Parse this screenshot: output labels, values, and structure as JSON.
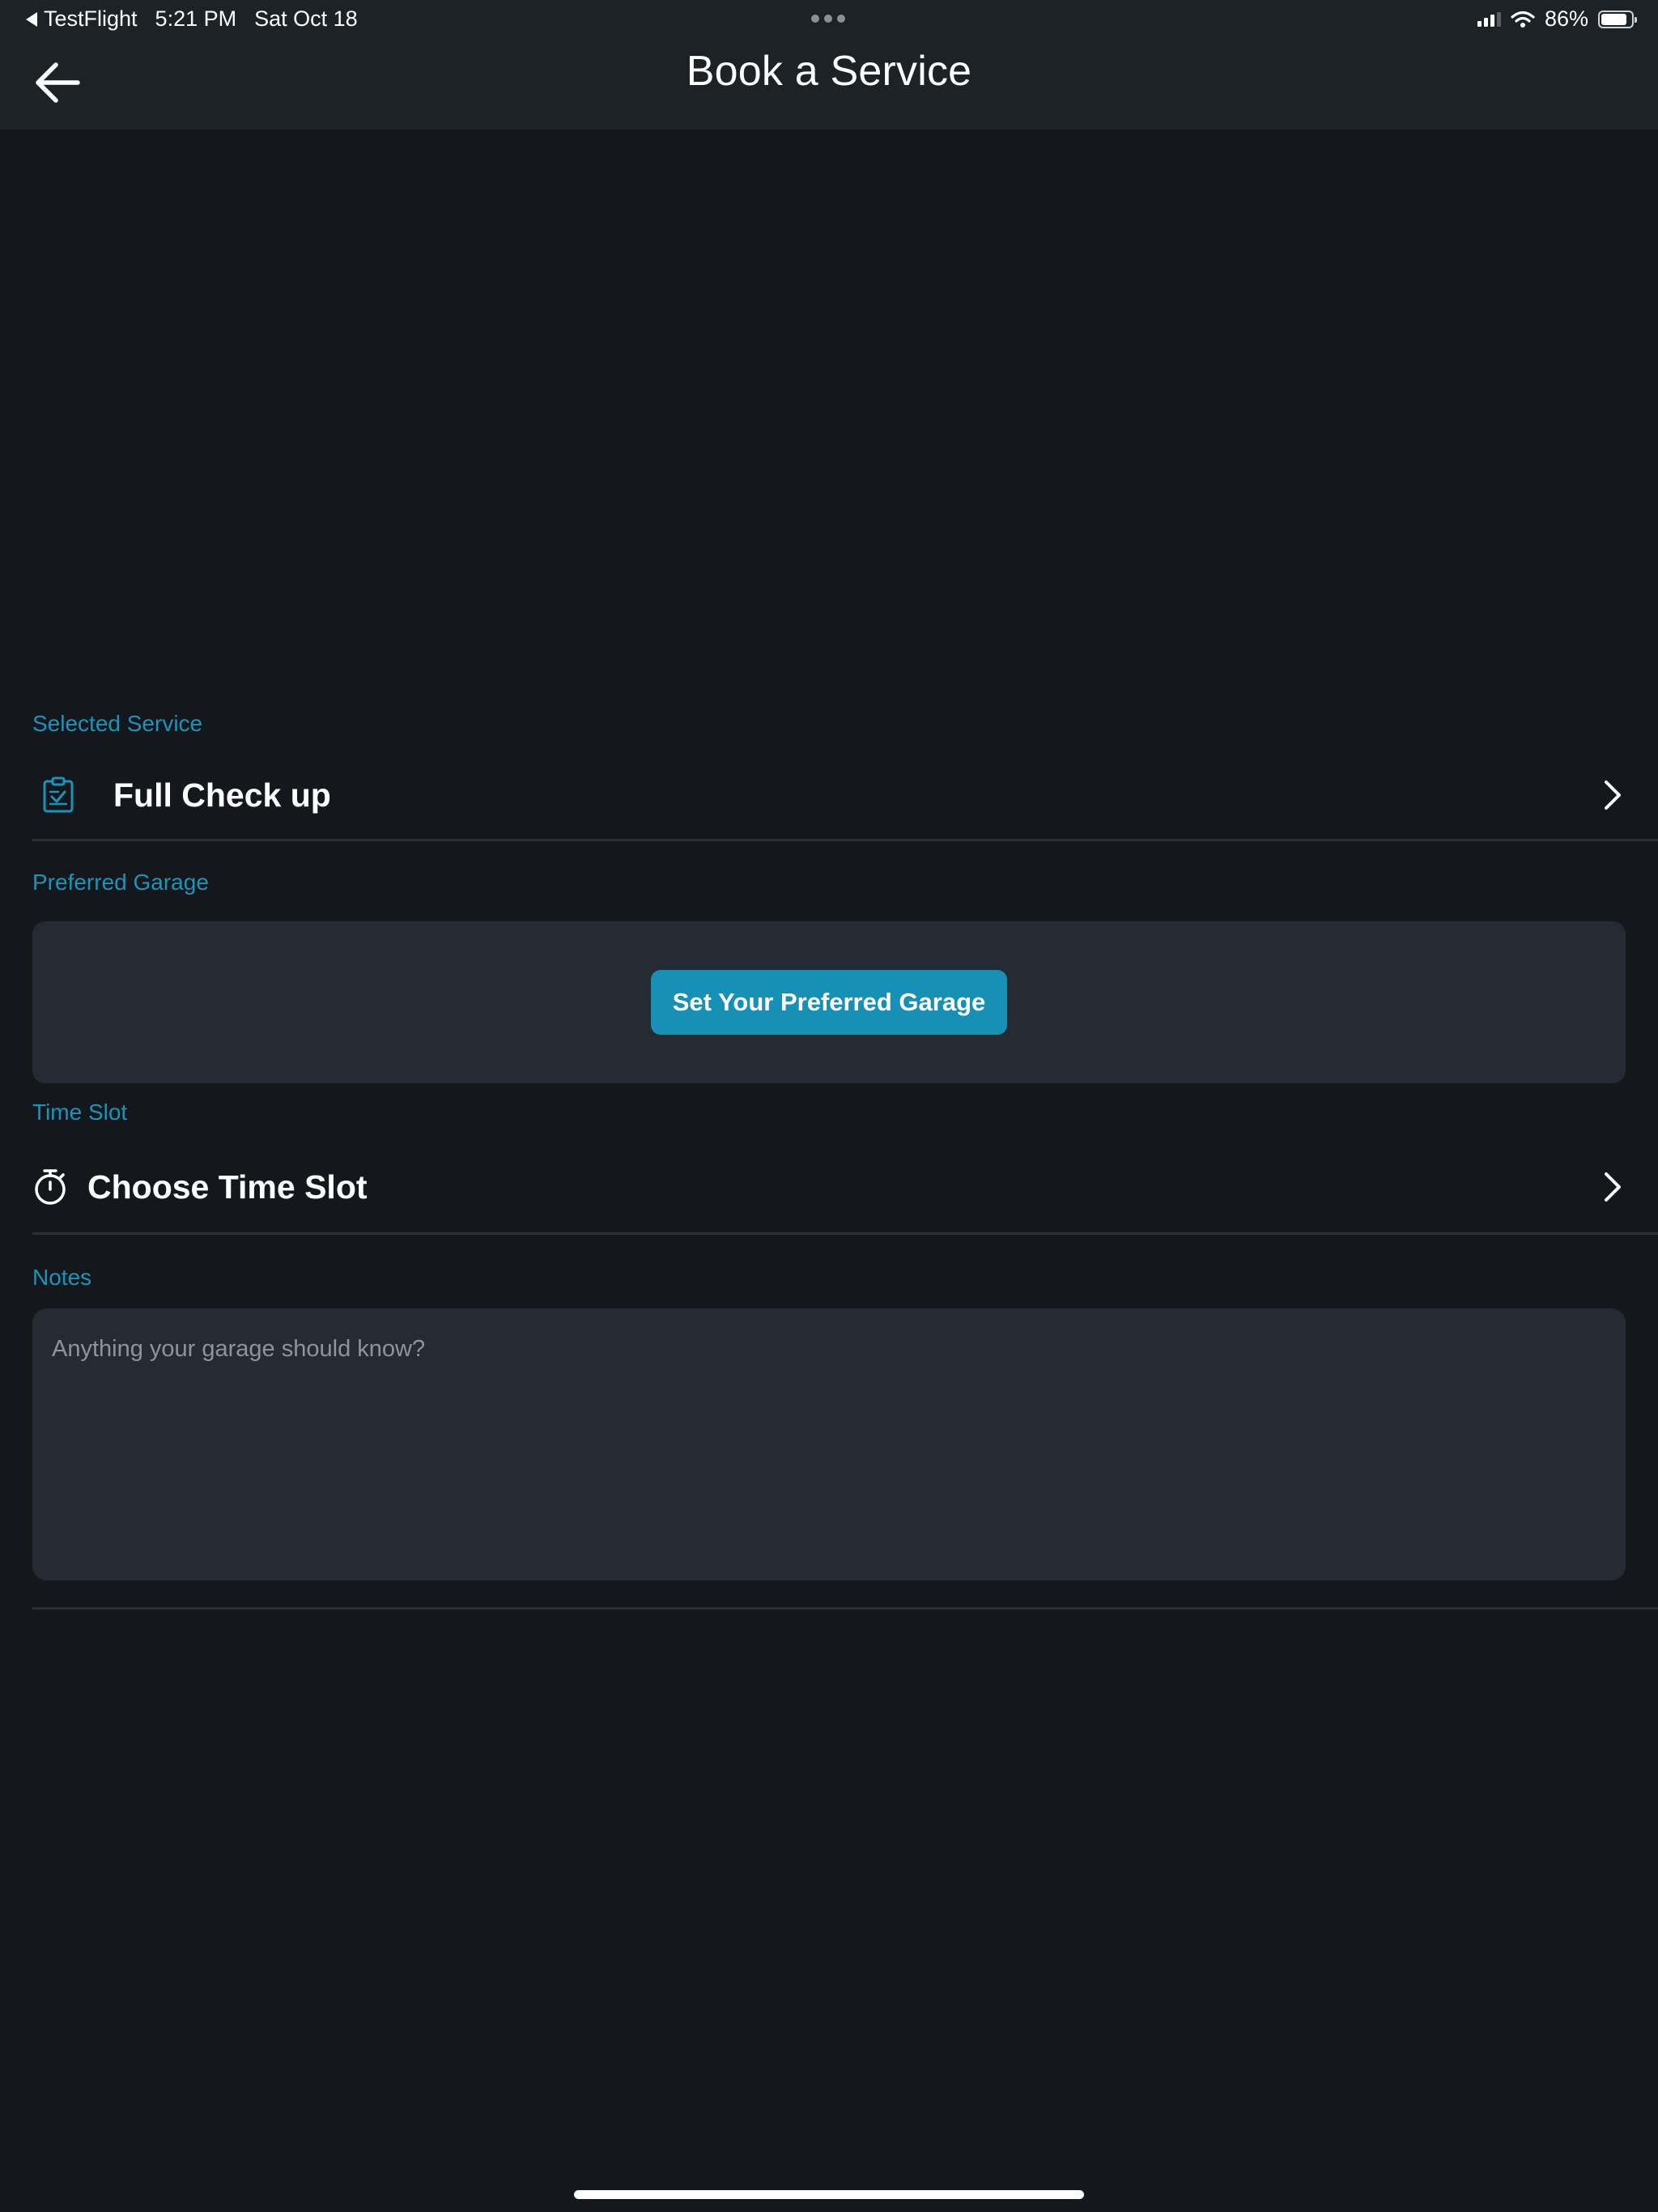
{
  "status_bar": {
    "back_app": "TestFlight",
    "time": "5:21 PM",
    "date": "Sat Oct 18",
    "battery_text": "86%",
    "battery_level": 0.86,
    "signal_bars_active": 3,
    "signal_bars_total": 4
  },
  "header": {
    "title": "Book a Service",
    "back_icon": "arrow-left-icon"
  },
  "selected_service": {
    "label": "Selected Service",
    "value": "Full Check up",
    "icon": "clipboard-check-icon"
  },
  "preferred_garage": {
    "label": "Preferred Garage",
    "button_label": "Set Your Preferred Garage"
  },
  "time_slot": {
    "label": "Time Slot",
    "value": "Choose Time Slot",
    "icon": "stopwatch-icon"
  },
  "notes": {
    "label": "Notes",
    "placeholder": "Anything your garage should know?",
    "value": ""
  },
  "colors": {
    "accent": "#1a95b9",
    "button": "#1690b5",
    "background": "#14171b",
    "header": "#1d2227",
    "card": "#262b33"
  }
}
